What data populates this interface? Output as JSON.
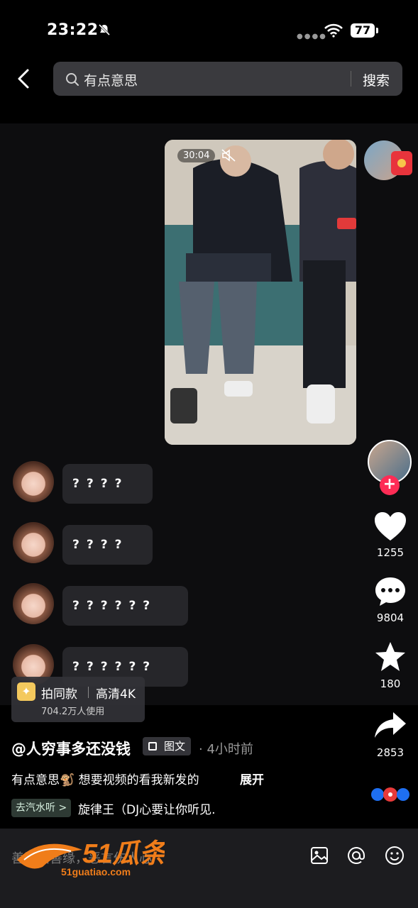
{
  "status_bar": {
    "time": "23:22",
    "battery": "77"
  },
  "header": {
    "search_query": "有点意思",
    "search_button": "搜索"
  },
  "video": {
    "duration": "30:04"
  },
  "chat": [
    {
      "text": "????"
    },
    {
      "text": "????"
    },
    {
      "text": "??????"
    },
    {
      "text": "??????"
    }
  ],
  "actions": {
    "likes": "1255",
    "comments": "9804",
    "favorites": "180",
    "shares": "2853"
  },
  "template_chip": {
    "label": "拍同款",
    "quality": "高清4K",
    "users": "704.2万人使用"
  },
  "post": {
    "author": "@人穷事多还没钱",
    "type_badge": "图文",
    "time_ago": "· 4小时前",
    "description": "有点意思🐒 想要视频的看我新发的",
    "expand": "展开",
    "music_tag": "去汽水听 >",
    "music": "旋律王（DJ心要让你听见."
  },
  "bottom_bar": {
    "comment_placeholder": "善语结善缘，恶言伤人心"
  },
  "watermark": {
    "brand": "51瓜条",
    "url": "51guatiao.com"
  },
  "colors": {
    "accent": "#fe2c55",
    "background": "#000000",
    "bubble": "#26262a"
  }
}
